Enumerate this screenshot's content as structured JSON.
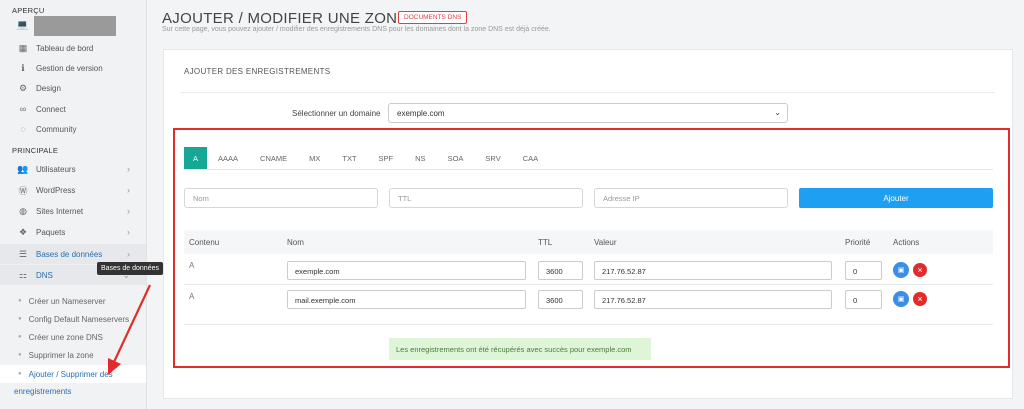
{
  "sidebar": {
    "section_apercu": "APERÇU",
    "items_top": [
      {
        "label": "Tableau de bord",
        "icon": "dashboard-icon"
      },
      {
        "label": "Gestion de version",
        "icon": "info-icon"
      },
      {
        "label": "Design",
        "icon": "gear-icon"
      },
      {
        "label": "Connect",
        "icon": "link-icon"
      },
      {
        "label": "Community",
        "icon": "chat-icon"
      }
    ],
    "section_principale": "PRINCIPALE",
    "items_main": [
      {
        "label": "Utilisateurs",
        "icon": "users-icon"
      },
      {
        "label": "WordPress",
        "icon": "wordpress-icon"
      },
      {
        "label": "Sites Internet",
        "icon": "globe-icon"
      },
      {
        "label": "Paquets",
        "icon": "packages-icon"
      },
      {
        "label": "Bases de données",
        "icon": "database-icon"
      },
      {
        "label": "DNS",
        "icon": "sitemap-icon"
      }
    ],
    "tooltip": "Bases de données",
    "dns_sub": [
      "Créer un Nameserver",
      "Config Default Nameservers",
      "Créer une zone DNS",
      "Supprimer la zone",
      "Ajouter / Supprimer des"
    ],
    "dns_sub_overflow": "enregistrements"
  },
  "header": {
    "title": "AJOUTER / MODIFIER UNE ZONE DNS -",
    "badge": "DOCUMENTS DNS",
    "subtitle": "Sur cette page, vous pouvez ajouter / modifier des enregistrements DNS pour les domaines dont la zone DNS est déjà créée."
  },
  "card": {
    "title": "AJOUTER DES ENREGISTREMENTS",
    "select_label": "Sélectionner un domaine",
    "select_value": "exemple.com"
  },
  "tabs": [
    "A",
    "AAAA",
    "CNAME",
    "MX",
    "TXT",
    "SPF",
    "NS",
    "SOA",
    "SRV",
    "CAA"
  ],
  "add_form": {
    "name_placeholder": "Nom",
    "ttl_placeholder": "TTL",
    "ip_placeholder": "Adresse IP",
    "add_button": "Ajouter"
  },
  "table": {
    "headers": [
      "Contenu",
      "Nom",
      "TTL",
      "Valeur",
      "Priorité",
      "Actions"
    ],
    "rows": [
      {
        "type": "A",
        "name": "exemple.com",
        "ttl": "3600",
        "value": "217.76.52.87",
        "priority": "0"
      },
      {
        "type": "A",
        "name": "mail.exemple.com",
        "ttl": "3600",
        "value": "217.76.52.87",
        "priority": "0"
      }
    ]
  },
  "success_message": "Les enregistrements ont été récupérés avec succès pour exemple.com",
  "colors": {
    "accent_tab": "#16a894",
    "add_button": "#1e9ff2",
    "highlight": "#e22b2b",
    "success_bg": "#dff5d8"
  }
}
